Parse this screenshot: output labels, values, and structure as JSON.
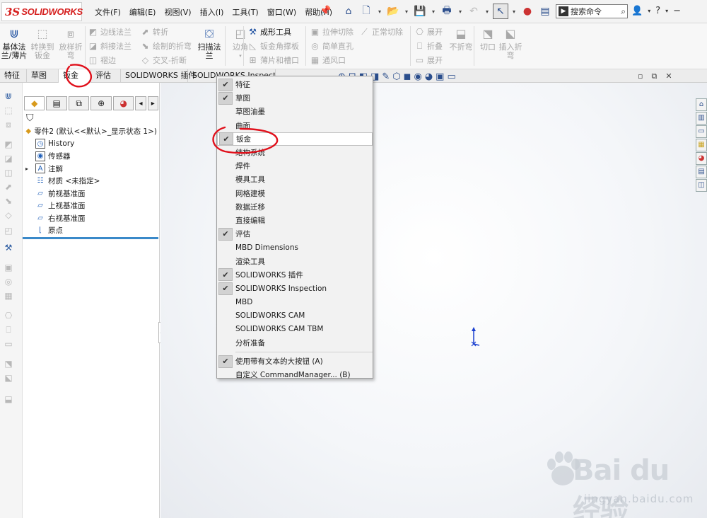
{
  "app": {
    "logo_mark": "3S",
    "logo_name": "SOLIDWORKS"
  },
  "menu": [
    "文件(F)",
    "编辑(E)",
    "视图(V)",
    "插入(I)",
    "工具(T)",
    "窗口(W)",
    "帮助(H)"
  ],
  "search": {
    "placeholder": "搜索命令"
  },
  "ribbon": {
    "big_buttons": [
      {
        "label": "基体法\n兰/薄片",
        "enabled": true
      },
      {
        "label": "转换到\n钣金",
        "enabled": false
      },
      {
        "label": "放样折\n弯",
        "enabled": false
      },
      {
        "label": "扫描法\n兰",
        "enabled": true
      },
      {
        "label": "边角",
        "enabled": false
      },
      {
        "label": "切口",
        "enabled": false
      },
      {
        "label": "插入折\n弯",
        "enabled": false
      }
    ],
    "small_buttons": [
      {
        "label": "边线法兰",
        "enabled": false
      },
      {
        "label": "斜接法兰",
        "enabled": false
      },
      {
        "label": "褶边",
        "enabled": false
      },
      {
        "label": "转折",
        "enabled": false
      },
      {
        "label": "绘制的折弯",
        "enabled": false
      },
      {
        "label": "交叉-折断",
        "enabled": false
      },
      {
        "label": "成形工具",
        "enabled": true
      },
      {
        "label": "钣金角撑板",
        "enabled": false
      },
      {
        "label": "薄片和槽口",
        "enabled": false
      },
      {
        "label": "拉伸切除",
        "enabled": false
      },
      {
        "label": "简单直孔",
        "enabled": false
      },
      {
        "label": "通风口",
        "enabled": false
      },
      {
        "label": "正常切除",
        "enabled": false
      },
      {
        "label": "展开",
        "enabled": false
      },
      {
        "label": "折叠",
        "enabled": false
      },
      {
        "label": "展开",
        "enabled": false
      },
      {
        "label": "不折弯",
        "enabled": false
      }
    ]
  },
  "tabs": [
    {
      "label": "特征",
      "active": false
    },
    {
      "label": "草图",
      "active": false
    },
    {
      "label": "钣金",
      "active": true
    },
    {
      "label": "评估",
      "active": false
    },
    {
      "label": "SOLIDWORKS 插件",
      "active": false
    },
    {
      "label": "SOLIDWORKS Inspection",
      "active": false
    }
  ],
  "feature_tree": {
    "root": "零件2  (默认<<默认>_显示状态 1>)",
    "items": [
      {
        "label": "History",
        "icon": "history-icon"
      },
      {
        "label": "传感器",
        "icon": "sensor-icon"
      },
      {
        "label": "注解",
        "icon": "annotation-icon",
        "expandable": true
      },
      {
        "label": "材质 <未指定>",
        "icon": "material-icon"
      },
      {
        "label": "前视基准面",
        "icon": "plane-icon"
      },
      {
        "label": "上视基准面",
        "icon": "plane-icon"
      },
      {
        "label": "右视基准面",
        "icon": "plane-icon"
      },
      {
        "label": "原点",
        "icon": "origin-icon"
      }
    ]
  },
  "context_menu": {
    "items": [
      {
        "label": "特征",
        "checked": true
      },
      {
        "label": "草图",
        "checked": true
      },
      {
        "label": "草图油墨",
        "checked": false
      },
      {
        "label": "曲面",
        "checked": false
      },
      {
        "label": "钣金",
        "checked": true,
        "highlighted": true
      },
      {
        "label": "结构系统",
        "checked": false
      },
      {
        "label": "焊件",
        "checked": false
      },
      {
        "label": "模具工具",
        "checked": false
      },
      {
        "label": "网格建模",
        "checked": false
      },
      {
        "label": "数据迁移",
        "checked": false
      },
      {
        "label": "直接编辑",
        "checked": false
      },
      {
        "label": "评估",
        "checked": true
      },
      {
        "label": "MBD Dimensions",
        "checked": false
      },
      {
        "label": "渲染工具",
        "checked": false
      },
      {
        "label": "SOLIDWORKS 插件",
        "checked": true
      },
      {
        "label": "SOLIDWORKS Inspection",
        "checked": true
      },
      {
        "label": "MBD",
        "checked": false
      },
      {
        "label": "SOLIDWORKS CAM",
        "checked": false
      },
      {
        "label": "SOLIDWORKS CAM TBM",
        "checked": false
      },
      {
        "label": "分析准备",
        "checked": false
      }
    ],
    "footer": [
      {
        "label": "使用带有文本的大按钮 (A)",
        "checked": true
      },
      {
        "label": "自定义 CommandManager... (B)",
        "checked": false
      }
    ]
  },
  "watermark": {
    "brand": "Bai du 经验",
    "url": "jingyan.baidu.com"
  },
  "colors": {
    "brand_red": "#d6201f",
    "annotation_red": "#e0101b",
    "tree_underline": "#3a89c9",
    "axis_blue": "#1a3fd0"
  }
}
